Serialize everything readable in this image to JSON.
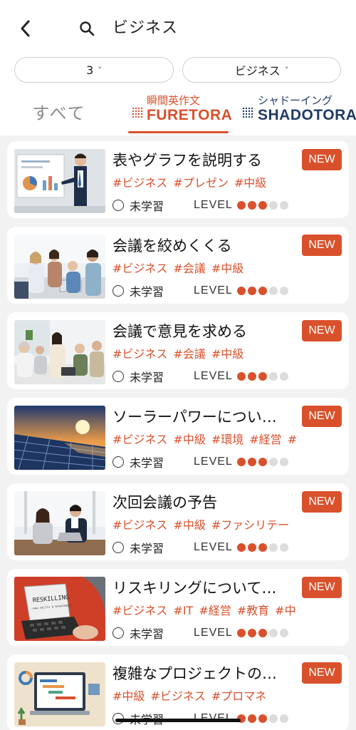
{
  "header": {
    "search_query": "ビジネス"
  },
  "filters": {
    "level": {
      "value": "3",
      "chevron": "˅"
    },
    "category": {
      "value": "ビジネス",
      "chevron": "˅"
    }
  },
  "tabs": {
    "all": {
      "label": "すべて"
    },
    "furetora": {
      "sub": "瞬間英作文",
      "brand": "FURETORA"
    },
    "shadotora": {
      "sub": "シャドーイング",
      "brand": "SHADOTORA"
    },
    "active": "furetora"
  },
  "colors": {
    "accent": "#d9512c",
    "navy": "#1f3a66"
  },
  "common": {
    "status_label": "未学習",
    "level_label": "LEVEL",
    "badge": "NEW"
  },
  "cards": [
    {
      "title": "表やグラフを説明する",
      "tags": [
        "#ビジネス",
        "#プレゼン",
        "#中級"
      ],
      "level": 3,
      "max_level": 5,
      "thumb": "presentation"
    },
    {
      "title": "会議を絞めくくる",
      "tags": [
        "#ビジネス",
        "#会議",
        "#中級"
      ],
      "level": 3,
      "max_level": 5,
      "thumb": "meeting"
    },
    {
      "title": "会議で意見を求める",
      "tags": [
        "#ビジネス",
        "#会議",
        "#中級"
      ],
      "level": 3,
      "max_level": 5,
      "thumb": "discussion"
    },
    {
      "title": "ソーラーパワーについ…",
      "tags": [
        "#ビジネス",
        "#中級",
        "#環境",
        "#経営",
        "#"
      ],
      "level": 3,
      "max_level": 5,
      "thumb": "solar"
    },
    {
      "title": "次回会議の予告",
      "tags": [
        "#ビジネス",
        "#中級",
        "#ファシリテー"
      ],
      "level": 3,
      "max_level": 5,
      "thumb": "duo"
    },
    {
      "title": "リスキリングについて…",
      "tags": [
        "#ビジネス",
        "#IT",
        "#経営",
        "#教育",
        "#中"
      ],
      "level": 3,
      "max_level": 5,
      "thumb": "reskilling",
      "thumb_text": "RESKILLING",
      "thumb_subtext": "—new skills & knowledge—"
    },
    {
      "title": "複雑なプロジェクトの…",
      "tags": [
        "#中級",
        "#ビジネス",
        "#プロマネ"
      ],
      "level": 3,
      "max_level": 5,
      "thumb": "project"
    }
  ]
}
